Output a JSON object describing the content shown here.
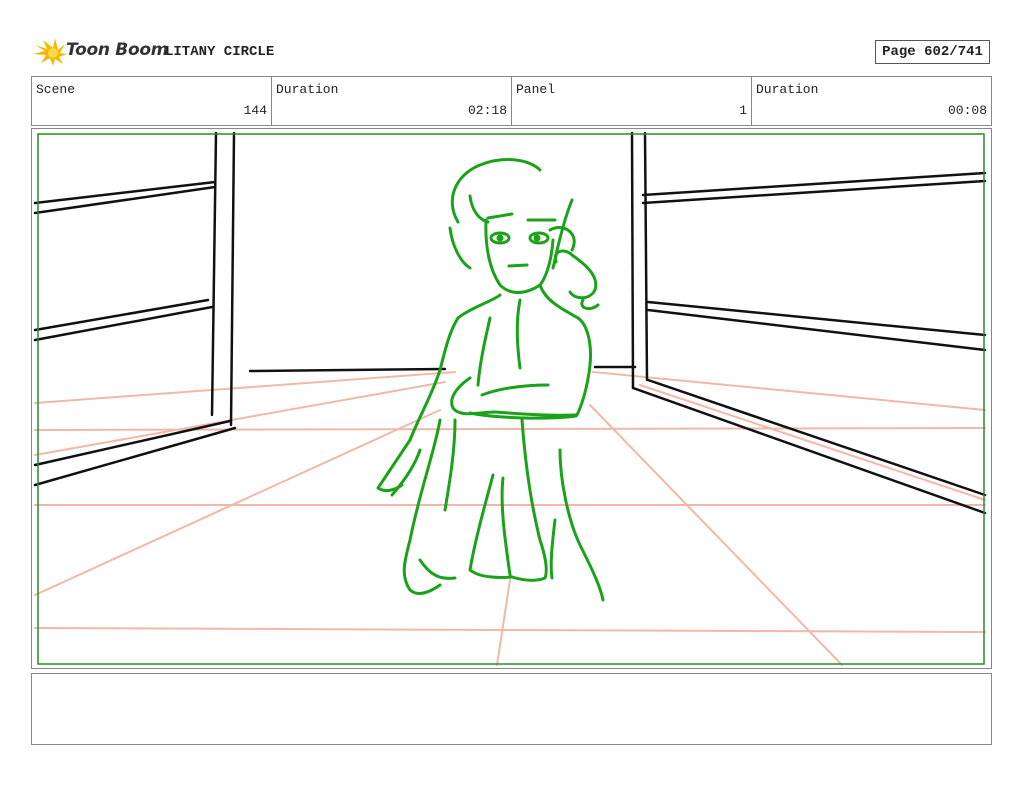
{
  "header": {
    "logo_text": "Toon Boom",
    "project_title": "LITANY CIRCLE",
    "page_label": "Page 602/741"
  },
  "info": {
    "scene_label": "Scene",
    "scene_value": "144",
    "scene_duration_label": "Duration",
    "scene_duration_value": "02:18",
    "panel_label": "Panel",
    "panel_value": "1",
    "panel_duration_label": "Duration",
    "panel_duration_value": "00:08"
  },
  "panel": {
    "safe_area_color": "#2a8a2a",
    "character_color": "#1aa31a",
    "perspective_color": "#f0b8a8",
    "room_line_color": "#111111"
  },
  "notes": {
    "text": ""
  }
}
